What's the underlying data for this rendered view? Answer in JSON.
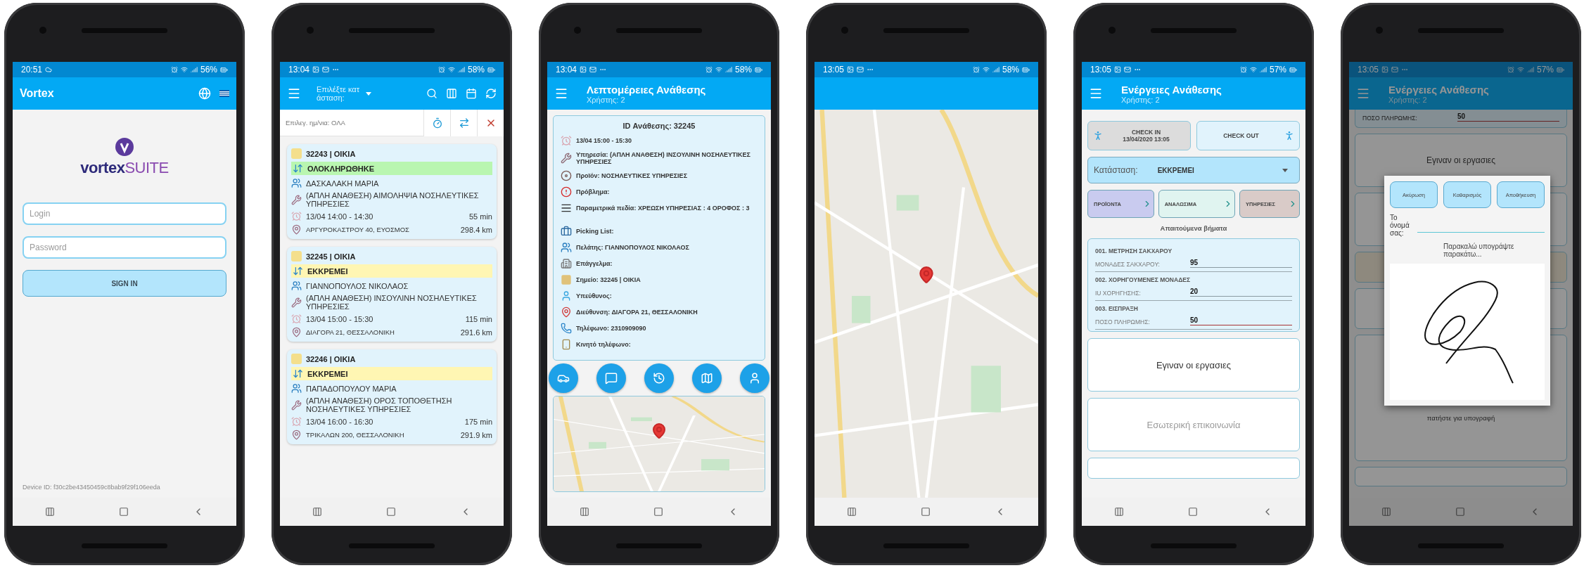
{
  "phones": [
    {
      "kind": "login",
      "status": {
        "time": "20:51",
        "battery": "56%"
      },
      "app_bar": {
        "title": "Vortex"
      },
      "logo": {
        "name": "vortex",
        "suffix": "SUITE"
      },
      "fields": [
        {
          "placeholder": "Login"
        },
        {
          "placeholder": "Password"
        }
      ],
      "button": "SIGN IN",
      "device_id": "Device ID: f30c2be43450459c8bab9f29f106eeda"
    },
    {
      "kind": "list",
      "status": {
        "time": "13:04",
        "battery": "58%"
      },
      "app_bar": {
        "dropdown": "Επιλέξτε κατάσταση:"
      },
      "filter": "Επιλεγ. ημ/νια: ΟΛΑ",
      "cards": [
        {
          "title": "32243 | ΟΙΚΙΑ",
          "status": "ΟΛΟΚΛΗΡΩΘΗΚΕ",
          "color": "#b9f6b0",
          "customer": "ΔΑΣΚΑΛΑΚΗ ΜΑΡΙΑ",
          "service": "(ΑΠΛΗ ΑΝΑΘΕΣΗ) ΑΙΜΟΛΗΨΙΑ ΝΟΣΗΛΕΥΤΙΚΕΣ ΥΠΗΡΕΣΙΕΣ",
          "time": "13/04 14:00 - 14:30",
          "duration": "55 min",
          "address": "ΑΡΓΥΡΟΚΑΣΤΡΟΥ 40, ΕΥΟΣΜΟΣ",
          "distance": "298.4 km"
        },
        {
          "title": "32245 | ΟΙΚΙΑ",
          "status": "ΕΚΚΡΕΜΕΙ",
          "color": "#fff6b3",
          "customer": "ΓΙΑΝΝΟΠΟΥΛΟΣ ΝΙΚΟΛΑΟΣ",
          "service": "(ΑΠΛΗ ΑΝΑΘΕΣΗ) ΙΝΣΟΥΛΙΝΗ ΝΟΣΗΛΕΥΤΙΚΕΣ ΥΠΗΡΕΣΙΕΣ",
          "time": "13/04 15:00 - 15:30",
          "duration": "115 min",
          "address": "ΔΙΑΓΟΡΑ 21, ΘΕΣΣΑΛΟΝΙΚΗ",
          "distance": "291.6 km"
        },
        {
          "title": "32246 | ΟΙΚΙΑ",
          "status": "ΕΚΚΡΕΜΕΙ",
          "color": "#fff6b3",
          "customer": "ΠΑΠΑΔΟΠΟΥΛΟΥ ΜΑΡΙΑ",
          "service": "(ΑΠΛΗ ΑΝΑΘΕΣΗ) ΟΡΟΣ ΤΟΠΟΘΕΤΗΣΗ ΝΟΣΗΛΕΥΤΙΚΕΣ ΥΠΗΡΕΣΙΕΣ",
          "time": "13/04 16:00 - 16:30",
          "duration": "175 min",
          "address": "ΤΡΙΚΑΛΩΝ 200, ΘΕΣΣΑΛΟΝΙΚΗ",
          "distance": "291.9 km"
        }
      ]
    },
    {
      "kind": "details",
      "status": {
        "time": "13:04",
        "battery": "58%"
      },
      "app_bar": {
        "title": "Λεπτομέρειες Ανάθεσης",
        "subtitle": "Χρήστης: 2"
      },
      "heading": "ID Ανάθεσης: 32245",
      "rows": [
        {
          "kind": "time",
          "text": "13/04 15:00 - 15:30"
        },
        {
          "kind": "service",
          "text": "Υπηρεσία: (ΑΠΛΗ ΑΝΑΘΕΣΗ) ΙΝΣΟΥΛΙΝΗ ΝΟΣΗΛΕΥΤΙΚΕΣ ΥΠΗΡΕΣΙΕΣ"
        },
        {
          "kind": "product",
          "text": "Προϊόν: ΝΟΣΗΛΕΥΤΙΚΕΣ ΥΠΗΡΕΣΙΕΣ"
        },
        {
          "kind": "problem",
          "text": "Πρόβλημα:"
        },
        {
          "kind": "fields",
          "text": "Παραμετρικά πεδία: ΧΡΕΩΣΗ ΥΠΗΡΕΣΙΑΣ : 4 ΟΡΟΦΟΣ : 3"
        },
        {
          "kind": "picking",
          "text": "Picking List:"
        },
        {
          "kind": "customer",
          "text": "Πελάτης: ΓΙΑΝΝΟΠΟΥΛΟΣ ΝΙΚΟΛΑΟΣ"
        },
        {
          "kind": "profession",
          "text": "Επάγγελμα:"
        },
        {
          "kind": "point",
          "text": "Σημείο: 32245 | ΟΙΚΙΑ"
        },
        {
          "kind": "responsible",
          "text": "Υπεύθυνος:"
        },
        {
          "kind": "address",
          "text": "Διεύθυνση: ΔΙΑΓΟΡΑ 21, ΘΕΣΣΑΛΟΝΙΚΗ"
        },
        {
          "kind": "phone",
          "text": "Τηλέφωνο: 2310909090"
        },
        {
          "kind": "mobile",
          "text": "Κινητό τηλέφωνο:"
        }
      ]
    },
    {
      "kind": "map",
      "status": {
        "time": "13:05",
        "battery": "58%"
      }
    },
    {
      "kind": "actions",
      "status": {
        "time": "13:05",
        "battery": "57%"
      },
      "app_bar": {
        "title": "Ενέργειες Ανάθεσης",
        "subtitle": "Χρήστης: 2"
      },
      "check_in": {
        "label": "CHECK IN",
        "date": "13/04/2020 13:05"
      },
      "check_out": "CHECK OUT",
      "state": {
        "label": "Κατάσταση:",
        "value": "ΕΚΚΡΕΜΕΙ"
      },
      "tiles": [
        {
          "label": "ΠΡΟΪΟΝΤΑ",
          "color": "#c9cbef"
        },
        {
          "label": "ΑΝΑΛΩΣΙΜΑ",
          "color": "#e0f4f0"
        },
        {
          "label": "ΥΠΗΡΕΣΙΕΣ",
          "color": "#d9cbc8"
        }
      ],
      "steps_heading": "Απαιτούμενα βήματα",
      "steps": [
        {
          "title": "001. ΜΕΤΡΗΣΗ ΣΑΚΧΑΡΟΥ",
          "label": "ΜΟΝΑΔΕΣ ΣΑΚΧΑΡΟΥ:",
          "value": "95",
          "focused": false
        },
        {
          "title": "002. ΧΟΡΗΓΟΥΜΕΝΕΣ ΜΟΝΑΔΕΣ",
          "label": "IU ΧΟΡΗΓΗΣΗΣ:",
          "value": "20",
          "focused": false
        },
        {
          "title": "003. ΕΙΣΠΡΑΞΗ",
          "label": "ΠΟΣΟ ΠΛΗΡΩΜΗΣ:",
          "value": "50",
          "focused": true
        }
      ],
      "buttons": [
        {
          "label": "Εγιναν οι εργασιες",
          "disabled": false
        },
        {
          "label": "Εσωτερική επικοινωνία",
          "disabled": true
        }
      ]
    },
    {
      "kind": "signature",
      "status": {
        "time": "13:05",
        "battery": "57%"
      },
      "app_bar": {
        "title": "Ενέργειες Ανάθεσης",
        "subtitle": "Χρήστης: 2"
      },
      "step": {
        "label": "ΠΟΣΟ ΠΛΗΡΩΜΗΣ:",
        "value": "50",
        "focused": true
      },
      "done_button": "Εγιναν οι εργασιες",
      "tap_hint": "πατήστε για υπογραφή",
      "dialog": {
        "buttons": [
          "Ακύρωση",
          "Καθαρισμός",
          "Αποθήκευση"
        ],
        "name_label": "Το όνομά σας:",
        "prompt": "Παρακαλώ υπογράψτε παρακάτω..."
      }
    }
  ]
}
